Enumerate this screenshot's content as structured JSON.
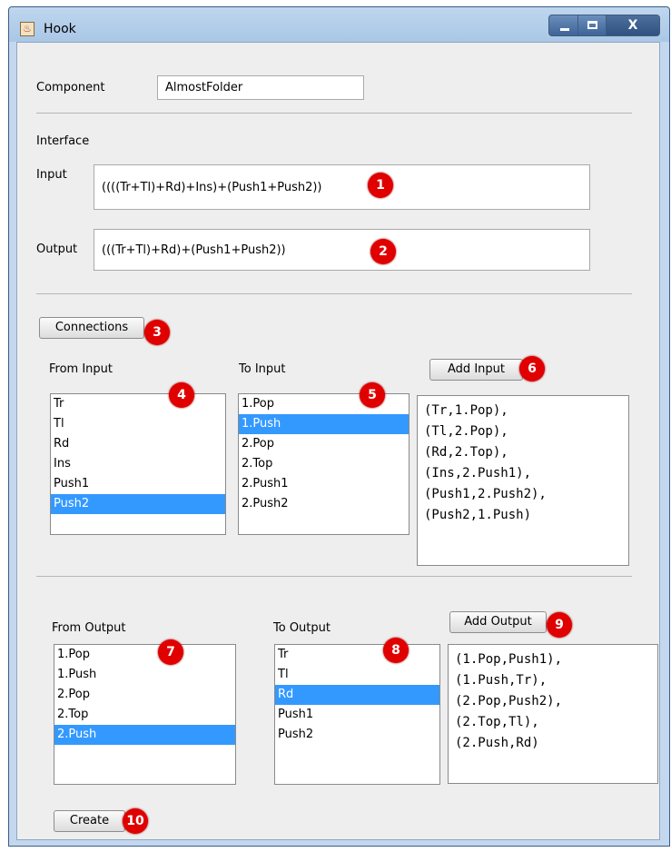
{
  "window": {
    "title": "Hook"
  },
  "component": {
    "label": "Component",
    "value": "AlmostFolder"
  },
  "interface": {
    "heading": "Interface",
    "input_label": "Input",
    "input_value": "((((Tr+Tl)+Rd)+Ins)+(Push1+Push2))",
    "output_label": "Output",
    "output_value": "(((Tr+Tl)+Rd)+(Push1+Push2))"
  },
  "connections_button": "Connections",
  "input_section": {
    "from_label": "From Input",
    "to_label": "To Input",
    "add_button": "Add Input",
    "from_items": [
      "Tr",
      "Tl",
      "Rd",
      "Ins",
      "Push1",
      "Push2"
    ],
    "from_selected": "Push2",
    "to_items": [
      "1.Pop",
      "1.Push",
      "2.Pop",
      "2.Top",
      "2.Push1",
      "2.Push2"
    ],
    "to_selected": "1.Push",
    "result_lines": [
      "(Tr,1.Pop),",
      "(Tl,2.Pop),",
      "(Rd,2.Top),",
      "(Ins,2.Push1),",
      "(Push1,2.Push2),",
      "(Push2,1.Push)"
    ]
  },
  "output_section": {
    "from_label": "From Output",
    "to_label": "To Output",
    "add_button": "Add Output",
    "from_items": [
      "1.Pop",
      "1.Push",
      "2.Pop",
      "2.Top",
      "2.Push"
    ],
    "from_selected": "2.Push",
    "to_items": [
      "Tr",
      "Tl",
      "Rd",
      "Push1",
      "Push2"
    ],
    "to_selected": "Rd",
    "result_lines": [
      "(1.Pop,Push1),",
      "(1.Push,Tr),",
      "(2.Pop,Push2),",
      "(2.Top,Tl),",
      "(2.Push,Rd)"
    ]
  },
  "create_button": "Create",
  "badges": [
    "1",
    "2",
    "3",
    "4",
    "5",
    "6",
    "7",
    "8",
    "9",
    "10"
  ],
  "colors": {
    "selection": "#3399ff",
    "badge": "#e00000",
    "titlebar": "#bfd6ee"
  }
}
